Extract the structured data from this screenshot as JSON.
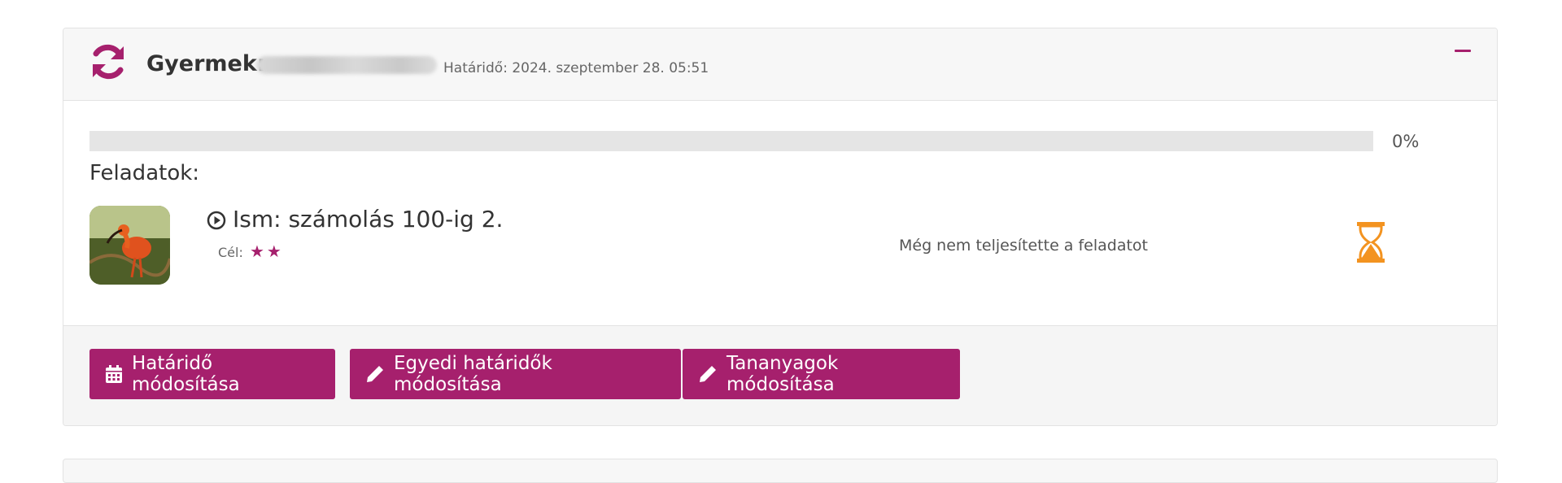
{
  "panel": {
    "header": {
      "child_label": "Gyermek:",
      "deadline": "Határidő: 2024. szeptember 28. 05:51",
      "sync_icon": "sync-icon",
      "collapse_icon": "minus-icon"
    },
    "progress": {
      "value": 0,
      "label": "0%"
    },
    "tasks_title": "Feladatok:",
    "tasks": [
      {
        "title": "Ism: számolás 100-ig 2.",
        "goal_label": "Cél:",
        "goal_stars": 2,
        "status": "Még nem teljesítette a feladatot",
        "status_icon": "hourglass-icon"
      }
    ],
    "buttons": {
      "deadline_edit": "Határidő módosítása",
      "custom_deadlines_edit": "Egyedi határidők módosítása",
      "materials_edit": "Tananyagok módosítása"
    }
  },
  "colors": {
    "accent": "#a6206d",
    "hourglass": "#f39320",
    "progress_track": "#e5e5e5"
  }
}
